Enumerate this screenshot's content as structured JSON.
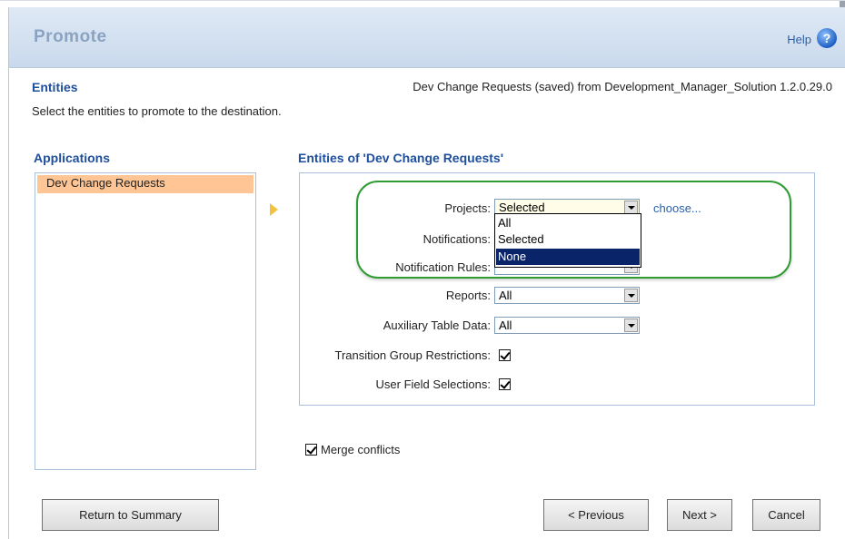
{
  "header": {
    "title": "Promote",
    "help_label": "Help",
    "help_icon": "?"
  },
  "section": {
    "title": "Entities",
    "source": "Dev Change Requests (saved) from Development_Manager_Solution 1.2.0.29.0",
    "instruction": "Select the entities to promote to the destination."
  },
  "applications": {
    "title": "Applications",
    "items": [
      "Dev Change Requests"
    ]
  },
  "entities": {
    "title": "Entities of 'Dev Change Requests'",
    "projects": {
      "label": "Projects:",
      "value": "Selected",
      "choose_link": "choose..."
    },
    "dropdown_options": [
      "All",
      "Selected",
      "None"
    ],
    "notifications": {
      "label": "Notifications:"
    },
    "notification_rules": {
      "label": "Notification Rules:"
    },
    "reports": {
      "label": "Reports:",
      "value": "All"
    },
    "auxiliary": {
      "label": "Auxiliary Table Data:",
      "value": "All"
    },
    "transition_group": {
      "label": "Transition Group Restrictions:",
      "checked": true
    },
    "user_field": {
      "label": "User Field Selections:",
      "checked": true
    }
  },
  "merge_conflicts": {
    "label": "Merge conflicts",
    "checked": true
  },
  "buttons": {
    "return": "Return to Summary",
    "previous": "< Previous",
    "next": "Next >",
    "cancel": "Cancel"
  },
  "colors": {
    "selected_row": "#ffc594",
    "highlight": "#2f9b33",
    "heading": "#1e4f9c"
  }
}
